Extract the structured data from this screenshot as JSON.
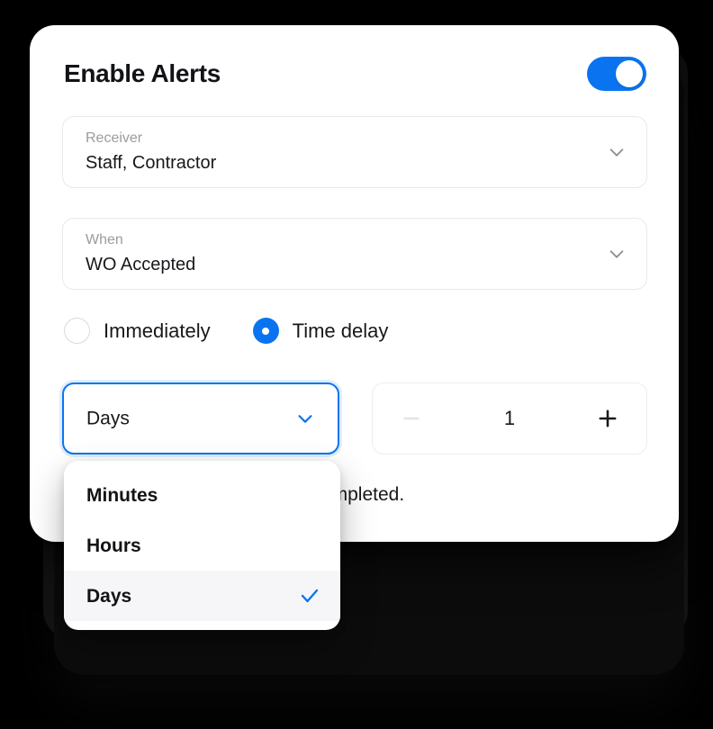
{
  "header": {
    "title": "Enable Alerts",
    "toggle": {
      "name": "enable-alerts-toggle",
      "state": "on"
    }
  },
  "fields": [
    {
      "key": "receiver",
      "label": "Receiver",
      "value": "Staff, Contractor",
      "icon": "chevron-down-icon"
    },
    {
      "key": "when",
      "label": "When",
      "value": "WO Accepted",
      "icon": "chevron-down-icon"
    }
  ],
  "timing": {
    "options": [
      {
        "label": "Immediately",
        "selected": false
      },
      {
        "label": "Time delay",
        "selected": true
      }
    ]
  },
  "unit_select": {
    "value": "Days",
    "icon": "chevron-down-icon",
    "focused": true
  },
  "stepper": {
    "minus_label": "–",
    "value": "1",
    "plus_label": "+",
    "minus_disabled": true
  },
  "description": {
    "text": "Send a reminder if WO is not completed."
  },
  "dropdown_menu": {
    "items": [
      {
        "label": "Minutes",
        "selected": false
      },
      {
        "label": "Hours",
        "selected": false
      },
      {
        "label": "Days",
        "selected": true
      }
    ],
    "check_icon": "check-icon"
  },
  "colors": {
    "accent": "#0A74F0",
    "text": "#17181B",
    "muted": "#9B9BA1",
    "border": "#E9E9EC",
    "disabled": "#E4E4E7",
    "selected_row": "#F6F6F8",
    "background": "#000000",
    "card": "#FFFFFF"
  }
}
